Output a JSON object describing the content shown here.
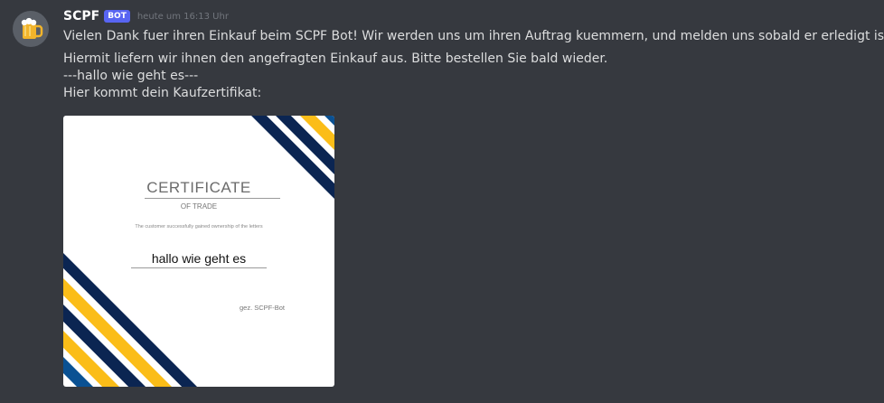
{
  "message": {
    "username": "SCPF",
    "bot_tag": "BOT",
    "timestamp": "heute um 16:13 Uhr",
    "lines": [
      "Vielen Dank fuer ihren Einkauf beim SCPF Bot! Wir werden uns um ihren Auftrag kuemmern, und melden uns sobald er erledigt ist.",
      "Hiermit liefern wir ihnen den angefragten Einkauf aus. Bitte bestellen Sie bald wieder.",
      "---hallo wie geht es---",
      "Hier kommt dein Kaufzertifikat:"
    ]
  },
  "certificate": {
    "title": "CERTIFICATE",
    "subtitle": "OF TRADE",
    "description": "The customer successfully gained ownership of the letters",
    "name": "hallo wie geht es",
    "signature": "gez. SCPF-Bot"
  },
  "colors": {
    "background": "#36393f",
    "bot_tag": "#5865f2",
    "stripe_navy": "#0b2552",
    "stripe_yellow": "#fbbd18",
    "stripe_blue": "#0a5193"
  },
  "icons": {
    "avatar": "beer-mug-icon"
  }
}
